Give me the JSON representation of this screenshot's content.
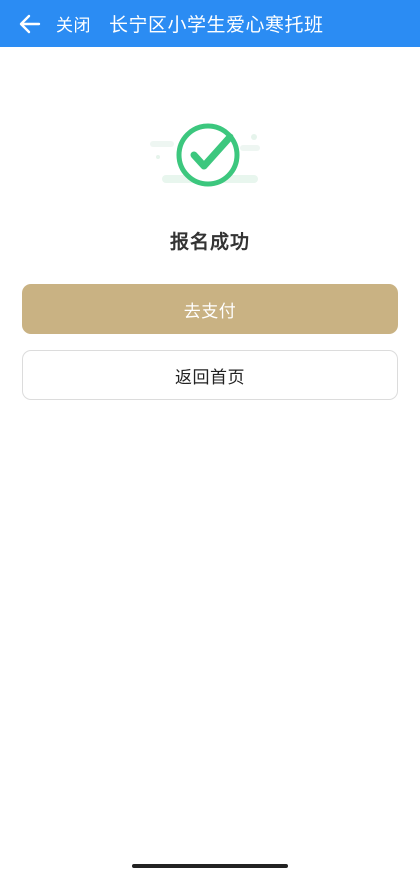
{
  "header": {
    "back_icon": "arrow-left-icon",
    "close_label": "关闭",
    "title": "长宁区小学生爱心寒托班",
    "background_color": "#2b8cf3"
  },
  "main": {
    "success_icon": "check-circle-icon",
    "status_text": "报名成功",
    "pay_button_label": "去支付",
    "home_button_label": "返回首页",
    "accent_color": "#c9b283",
    "success_color": "#3cc77e"
  }
}
